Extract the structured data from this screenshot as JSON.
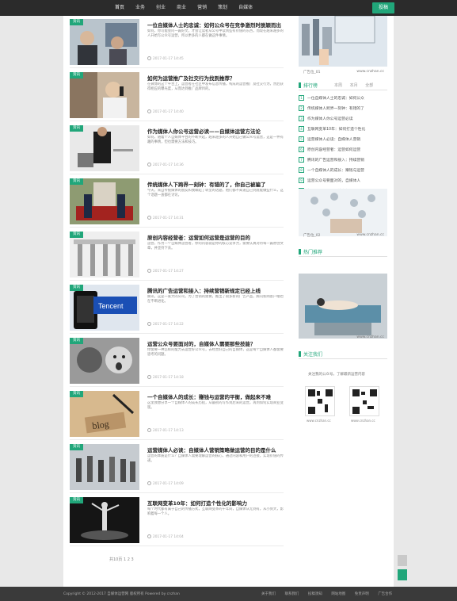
{
  "topbar": {
    "nav": [
      "首页",
      "业务",
      "创业",
      "商业",
      "营销",
      "策划",
      "自媒体"
    ],
    "post_button": "投稿"
  },
  "tag_label": "资讯",
  "articles": [
    {
      "title": "一位自媒体人士的忠诚：如何公众号在竞争激烈时脱颖而出",
      "excerpt": "如何，你可能会问一篇好文，才会让读者从公号中读到些有价值的东西，而现在越来越多的人开始写公众号运营，所以更多的人都在做这件事情。",
      "date": "2017-01-17 14:45"
    },
    {
      "title": "如何为运营推广及社交行为找到推荐？",
      "excerpt": "在微博的这个平台上，运营者在社区中发布信息传播，构成的运营推广及社交行为，然后获得相应的曝光度，从而达到推广品牌目的。",
      "date": "2017-01-17 14:40"
    },
    {
      "title": "作为媒体人你公号运营必读——自媒体运营方法论",
      "excerpt": "如何，随着个人自媒体平台的不断兴起，越来越多的人开始自己做公众号运营，这是一件有趣的事情，但也需要方法和技巧。",
      "date": "2017-01-17 14:36"
    },
    {
      "title": "传统媒体人下跨界一刻钟：有错的了，你自己被骗了",
      "excerpt": "今天，来自传统媒体的朋友和我聊起了转型的话题，他们都不知道自己到底能做些什么，这个话题一直都在讨论。",
      "date": "2017-01-17 14:31"
    },
    {
      "title": "原创内容经营者：运营如何运营是运营的目的",
      "excerpt": "运营，作为一个自媒体运营者，你的内容就是你的核心竞争力，需要认真对待每一篇原创文章，并坚持下去。",
      "date": "2017-01-17 14:27"
    },
    {
      "title": "腾讯的广告运营和接入：持续营销新规定已经上线",
      "excerpt": "腾讯，这是一家大的公司，为了营销的需要，推出了很多新的广告产品，腾讯新闻客户端也在不断进化。",
      "date": "2017-01-17 14:22"
    },
    {
      "title": "运营公众号要面对的，自媒体人需要那些技能？",
      "excerpt": "你需要一种怎样的能力去运营好公众号，去经营好自己的自媒体，这是每个自媒体人都需要思考的问题。",
      "date": "2017-01-17 14:18"
    },
    {
      "title": "一个自媒体人的成长：赚钱与运营的平衡，做起来不难",
      "excerpt": "这里我想分享一个自媒体人的成长历程，从最初的写作到后来的运营，再到如何实现商业变现。",
      "date": "2017-01-17 14:13"
    },
    {
      "title": "运营媒体人必读：自媒体人营销策略做运营的目的是什么",
      "excerpt": "运营的本质是什么？自媒体人需要理解运营的核心，通过内容和用户的连接，实现价值的传递。",
      "date": "2017-01-17 14:09"
    },
    {
      "title": "互联网变革10年：如何打造个性化的影响力",
      "excerpt": "每个时代都有属于自己的传播方式，互联网变革的十年间，自媒体从无到有，从小到大，影响着每一个人。",
      "date": "2017-01-17 14:04"
    }
  ],
  "pagination": "共10页 1 2 3",
  "sidebar": {
    "ad1_left": "广告位_01",
    "ad1_right": "www.cnzhan.cc",
    "rank_title": "排行榜",
    "rank_tabs": [
      "本周",
      "本月",
      "全部"
    ],
    "rank_items": [
      "一位自媒体人士的忠诚：如何公众",
      "传统媒体人跨界一刻钟：有错的了",
      "作为媒体人你公号运营必读",
      "互联网变革10年：如何打造个性化",
      "运营媒体人必读：自媒体人营销",
      "原创内容经营者：运营如何运营",
      "腾讯的广告运营和接入：持续营销",
      "一个自媒体人的成长：赚钱与运营",
      "运营公众号要面对的，自媒体人",
      "如何为运营推广及社交行为找到"
    ],
    "ad2_left": "广告位_02",
    "ad2_right": "www.cnzhan.cc",
    "popular_title": "热门推荐",
    "ad3_right": "www.cnzhan.cc",
    "qr_title": "关注我们",
    "qr_desc": "关注我的公众号，了解最新运营内容",
    "qr1_caption": "www.cnzhan.cc",
    "qr2_caption": "www.cnzhan.cc"
  },
  "footer": {
    "copyright": "Copyright © 2012-2017 自媒体运营网 版权所有 Powered by cnzhan",
    "links": [
      "关于我们",
      "联系我们",
      "投稿须知",
      "网站地图",
      "免责声明",
      "广告合作"
    ]
  },
  "colors": {
    "accent": "#21a67a",
    "topbar": "#2b2b2b",
    "footer": "#3a3a3a"
  }
}
